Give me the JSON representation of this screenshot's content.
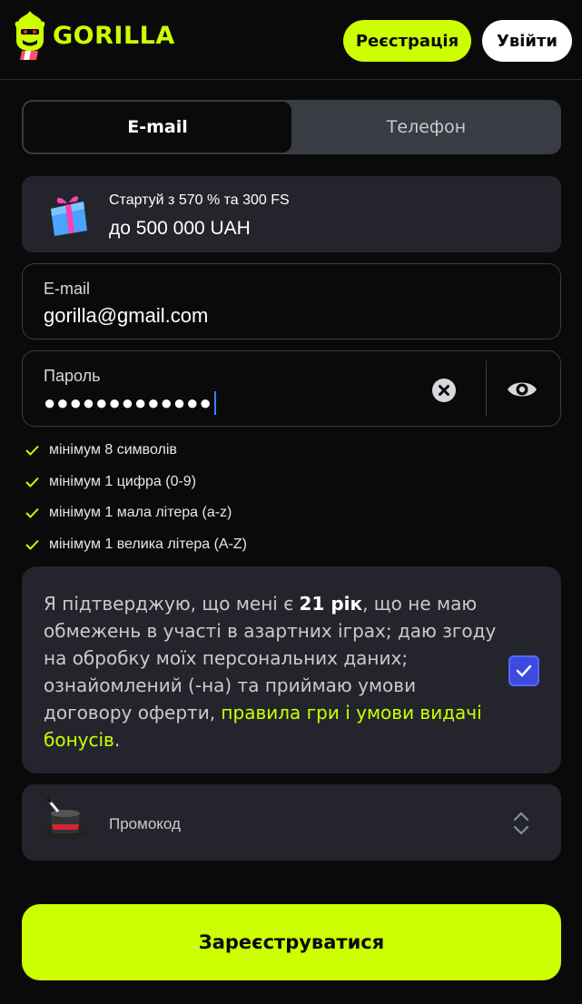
{
  "header": {
    "logo_text": "GORILLA",
    "register_label": "Реєстрація",
    "login_label": "Увійти"
  },
  "tabs": [
    {
      "label": "E-mail",
      "active": true
    },
    {
      "label": "Телефон",
      "active": false
    }
  ],
  "promo": {
    "line1": "Стартуй з 570 % та 300 FS",
    "line2": "до 500 000 UAH"
  },
  "email_field": {
    "label": "E-mail",
    "value": "gorilla@gmail.com"
  },
  "password_field": {
    "label": "Пароль",
    "masked_value": "●●●●●●●●●●●●●"
  },
  "password_rules": [
    {
      "text": "мінімум 8 символів",
      "met": true
    },
    {
      "text": "мінімум 1 цифра (0-9)",
      "met": true
    },
    {
      "text": "мінімум 1 мала літера (a-z)",
      "met": true
    },
    {
      "text": "мінімум 1 велика літера (A-Z)",
      "met": true
    }
  ],
  "consent": {
    "part1": "Я підтверджую, що мені є ",
    "age": "21 рік",
    "part2": ", що не маю обмежень в участі в азартних іграх; даю згоду на обробку моїх персональних даних; ознайомлений (-на) та приймаю умови договору оферти, ",
    "link1": "правила гри",
    "and": " і ",
    "link2": "умови видачі бонусів",
    "end": ".",
    "checked": true
  },
  "promocode": {
    "label": "Промокод"
  },
  "submit_label": "Зареєструватися",
  "colors": {
    "accent": "#ccff00",
    "background": "#0a0a0b",
    "card": "#24252c",
    "checkbox": "#3d4ae0"
  }
}
